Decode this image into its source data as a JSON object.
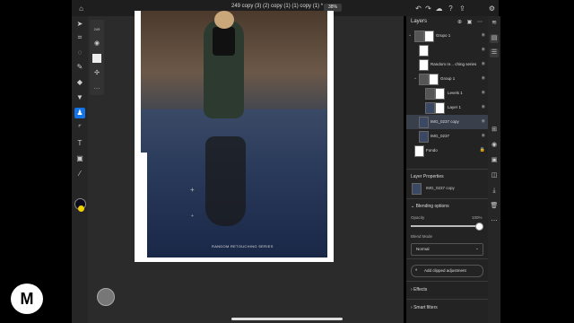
{
  "header": {
    "title": "249 copy (3) (2) copy (1) (1) copy (1) *",
    "zoom": "38%"
  },
  "icons": {
    "home": "home-icon",
    "undo": "undo-icon",
    "redo": "redo-icon",
    "cloud": "cloud-icon",
    "help": "help-icon",
    "share": "share-icon",
    "settings": "gear-icon"
  },
  "toolbar": {
    "brush_size": "249",
    "tools": [
      "move",
      "lasso",
      "quick-select",
      "brush",
      "eraser",
      "fill",
      "stamp",
      "crop",
      "type",
      "image",
      "eyedropper"
    ]
  },
  "canvas": {
    "caption": "RANDOM RETOUCHING SERIES"
  },
  "layers_panel": {
    "title": "Layers",
    "layers": [
      {
        "name": "Grupo 1",
        "indent": 0,
        "expanded": true
      },
      {
        "name": "",
        "indent": 1
      },
      {
        "name": "Random re... ching series",
        "indent": 1
      },
      {
        "name": "Group 1",
        "indent": 1,
        "expanded": true
      },
      {
        "name": "Levels 1",
        "indent": 2
      },
      {
        "name": "Layer 1",
        "indent": 2
      },
      {
        "name": "IMG_0237 copy",
        "indent": 1,
        "selected": true
      },
      {
        "name": "IMG_0237",
        "indent": 1
      },
      {
        "name": "Fondo",
        "indent": 0,
        "locked": true
      }
    ]
  },
  "properties": {
    "title": "Layer Properties",
    "layer_name": "IMG_0237 copy",
    "blending_title": "Blending options",
    "opacity_label": "Opacity",
    "opacity_value": "100%",
    "opacity_fraction": 1.0,
    "blend_mode_label": "Blend Mode",
    "blend_mode": "Normal",
    "clip_button": "Add clipped adjustment",
    "effects": "Effects",
    "smart_filters": "Smart filters"
  },
  "colors": {
    "accent": "#1473e6",
    "panel_bg": "#232323",
    "foreground": "#0a0a1a",
    "background": "#f0d000"
  }
}
